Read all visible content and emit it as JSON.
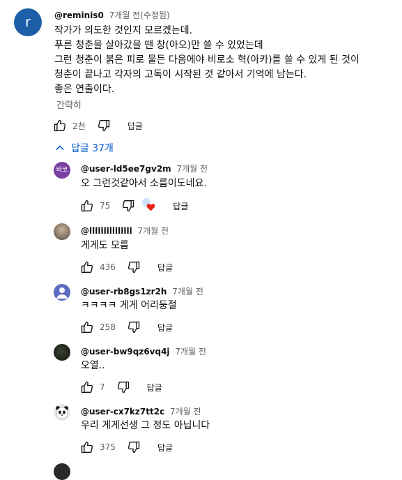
{
  "main_comment": {
    "avatar_letter": "r",
    "handle": "@reminis0",
    "time": "7개월 전(수정됨)",
    "lines": [
      "작가가 의도한 것인지 모르겠는데.",
      "푸른 청춘을 살아갔을 땐 창(아오)만 쓸 수 있었는데",
      "그런 청춘이 붉은 피로 물든 다음에야 비로소 혁(아카)를 쓸 수 있게 된 것이",
      "청춘이 끝나고 각자의 고독이 시작된 것 같아서 기억에 남는다.",
      "좋은 연출이다."
    ],
    "read_less": "간략히",
    "likes": "2천",
    "reply_label": "답글"
  },
  "replies_toggle": {
    "label": "답글 37개"
  },
  "replies": [
    {
      "avatar": "바코",
      "avatar_color": "#7b3fa3",
      "handle": "@user-ld5ee7gv2m",
      "time": "7개월 전",
      "text": "오 그런것같아서 소름이도네요.",
      "likes": "75",
      "reply_label": "답글",
      "creator_heart": true
    },
    {
      "avatar": "",
      "avatar_color": "#8a7a6a",
      "handle": "@lllllllllllllll",
      "time": "7개월 전",
      "text": "게게도 모름",
      "likes": "436",
      "reply_label": "답글"
    },
    {
      "avatar": "",
      "avatar_color": "#5c6bc0",
      "handle": "@user-rb8gs1zr2h",
      "time": "7개월 전",
      "text": "ㅋㅋㅋㅋ 게게 어리둥절",
      "likes": "258",
      "reply_label": "답글"
    },
    {
      "avatar": "",
      "avatar_color": "#1e2218",
      "handle": "@user-bw9qz6vq4j",
      "time": "7개월 전",
      "text": "오열..",
      "likes": "7",
      "reply_label": "답글"
    },
    {
      "avatar": "",
      "avatar_color": "#e8e8e8",
      "handle": "@user-cx7kz7tt2c",
      "time": "7개월 전",
      "text": "우리 게게선생 그 정도 아닙니다",
      "likes": "375",
      "reply_label": "답글"
    }
  ]
}
